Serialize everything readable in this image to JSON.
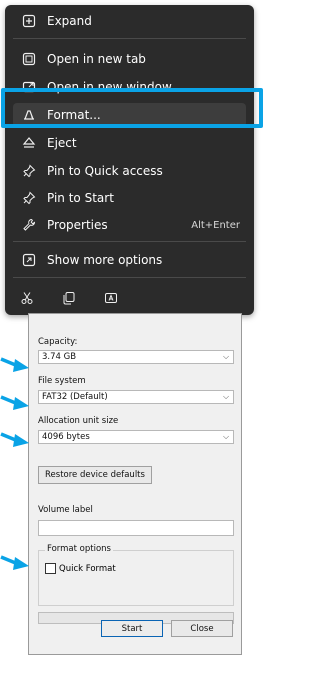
{
  "context_menu": {
    "items": [
      {
        "label": "Expand",
        "icon": "expand-icon"
      },
      {
        "label": "Open in new tab",
        "icon": "new-tab-icon"
      },
      {
        "label": "Open in new window",
        "icon": "new-window-icon"
      },
      {
        "label": "Format...",
        "icon": "format-drive-icon",
        "selected": true
      },
      {
        "label": "Eject",
        "icon": "eject-icon"
      },
      {
        "label": "Pin to Quick access",
        "icon": "pin-icon"
      },
      {
        "label": "Pin to Start",
        "icon": "pin-icon"
      },
      {
        "label": "Properties",
        "icon": "wrench-icon",
        "shortcut": "Alt+Enter"
      },
      {
        "label": "Show more options",
        "icon": "more-options-icon"
      }
    ],
    "action_icons": [
      "cut-icon",
      "copy-icon",
      "rename-icon"
    ],
    "highlight_color": "#0aa3e6"
  },
  "format_dialog": {
    "capacity": {
      "label": "Capacity:",
      "value": "3.74 GB"
    },
    "file_system": {
      "label": "File system",
      "value": "FAT32 (Default)"
    },
    "allocation_unit_size": {
      "label": "Allocation unit size",
      "value": "4096 bytes"
    },
    "restore_defaults_label": "Restore device defaults",
    "volume_label": {
      "label": "Volume label",
      "value": ""
    },
    "format_options": {
      "title": "Format options",
      "quick_format_label": "Quick Format",
      "quick_format_checked": false
    },
    "progress": 0,
    "start_label": "Start",
    "close_label": "Close"
  },
  "annotations": {
    "arrow_color": "#0aa3e6"
  }
}
